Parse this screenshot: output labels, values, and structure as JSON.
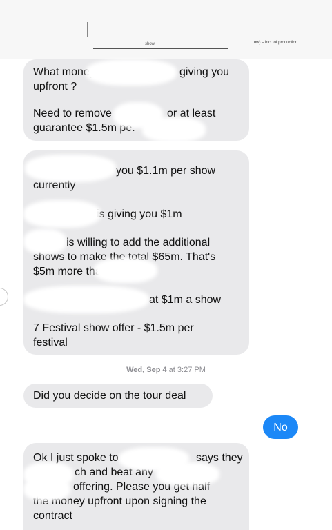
{
  "document_snippet": {
    "top_fragment": "",
    "show_fragment": "show,",
    "right_fragment": "...ow) – incl. of production"
  },
  "conversation": {
    "messages": [
      {
        "direction": "incoming",
        "lines": [
          "What money",
          "giving you",
          "upfront ?",
          "Need to remove",
          "or at least",
          "guarantee $1.5m pe."
        ]
      },
      {
        "direction": "incoming",
        "lines": [
          "you $1.1m per show",
          "currently",
          "is giving you $1m",
          "is willing to add the additional",
          "shows to make the total $65m. That's",
          "$5m more tha",
          "at $1m a show",
          "7 Festival show offer - $1.5m per",
          "festival"
        ]
      },
      {
        "direction": "incoming",
        "lines": [
          "Did you decide on the tour deal"
        ]
      },
      {
        "direction": "outgoing",
        "lines": [
          "No"
        ]
      },
      {
        "direction": "incoming",
        "lines": [
          "Ok I just spoke to",
          "says they",
          "ch and beat any",
          "offering. Please you get half",
          "the money upfront upon signing the",
          "contract"
        ]
      }
    ],
    "timestamp": {
      "day": "Wed, Sep 4",
      "time": "at 3:27 PM"
    }
  },
  "colors": {
    "incoming_bubble": "#e9e9eb",
    "outgoing_bubble": "#1c88f7",
    "timestamp_text": "#8e8e93"
  }
}
